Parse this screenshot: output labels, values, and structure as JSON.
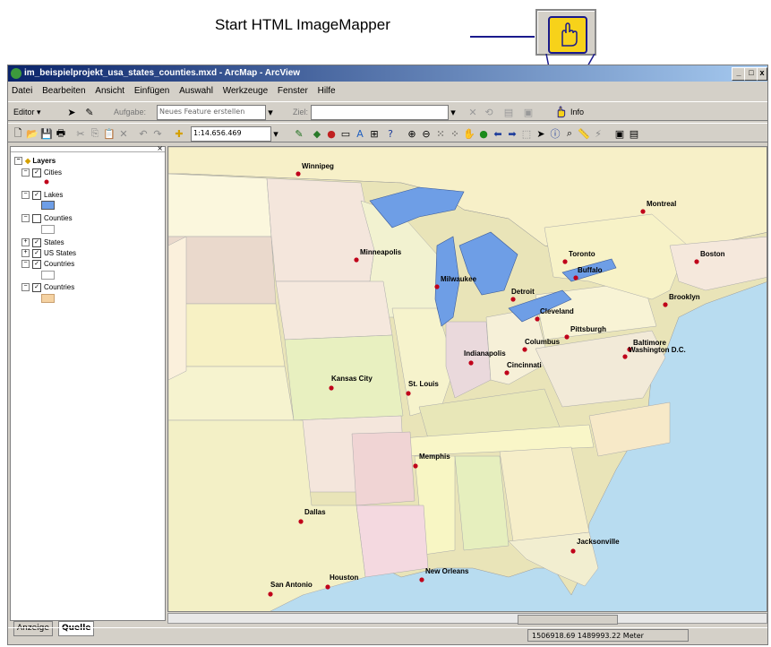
{
  "callout": {
    "text": "Start HTML ImageMapper"
  },
  "window": {
    "title": "im_beispielprojekt_usa_states_counties.mxd - ArcMap - ArcView",
    "minimize": "_",
    "maximize": "□",
    "close": "x"
  },
  "menu": [
    "Datei",
    "Bearbeiten",
    "Ansicht",
    "Einfügen",
    "Auswahl",
    "Werkzeuge",
    "Fenster",
    "Hilfe"
  ],
  "toolbar1": {
    "editor_label": "Editor",
    "task_label": "Aufgabe:",
    "task_value": "Neues Feature erstellen",
    "target_label": "Ziel:",
    "target_value": "",
    "info_label": "Info"
  },
  "toolbar2": {
    "scale_value": "1:14.656.469"
  },
  "toc": {
    "root_label": "Layers",
    "layers": [
      {
        "label": "Cities",
        "checked": true,
        "symbol": "point",
        "color": "#c0001a"
      },
      {
        "label": "Lakes",
        "checked": true,
        "symbol": "fill",
        "color": "#6e9ee6"
      },
      {
        "label": "Counties",
        "checked": false,
        "symbol": "fill",
        "color": "#ffffff"
      },
      {
        "label": "States",
        "checked": true,
        "symbol": "none",
        "color": ""
      },
      {
        "label": "US States",
        "checked": true,
        "symbol": "none",
        "color": ""
      },
      {
        "label": "Countries",
        "checked": true,
        "symbol": "fill",
        "color": "#ffffff"
      },
      {
        "label": "Countries",
        "checked": true,
        "symbol": "fill",
        "color": "#f5d2a2"
      }
    ],
    "tab_display": "Anzeige",
    "tab_source": "Quelle"
  },
  "map": {
    "cities": [
      {
        "name": "Winnipeg"
      },
      {
        "name": "Montreal"
      },
      {
        "name": "Minneapolis"
      },
      {
        "name": "Toronto"
      },
      {
        "name": "Boston"
      },
      {
        "name": "Buffalo"
      },
      {
        "name": "Milwaukee"
      },
      {
        "name": "Detroit"
      },
      {
        "name": "Brooklyn"
      },
      {
        "name": "Cleveland"
      },
      {
        "name": "Pittsburgh"
      },
      {
        "name": "Baltimore"
      },
      {
        "name": "Columbus"
      },
      {
        "name": "Washington D.C."
      },
      {
        "name": "Indianapolis"
      },
      {
        "name": "Cincinnati"
      },
      {
        "name": "Kansas City"
      },
      {
        "name": "St. Louis"
      },
      {
        "name": "Memphis"
      },
      {
        "name": "Dallas"
      },
      {
        "name": "Jacksonville"
      },
      {
        "name": "New Orleans"
      },
      {
        "name": "Houston"
      },
      {
        "name": "San Antonio"
      }
    ],
    "colors": {
      "water": "#b8dcf0",
      "lake": "#6e9ee6",
      "city": "#c0001a",
      "canada": "#f7f0c8"
    }
  },
  "status": {
    "coords": "1506918.69 1489993.22 Meter"
  }
}
